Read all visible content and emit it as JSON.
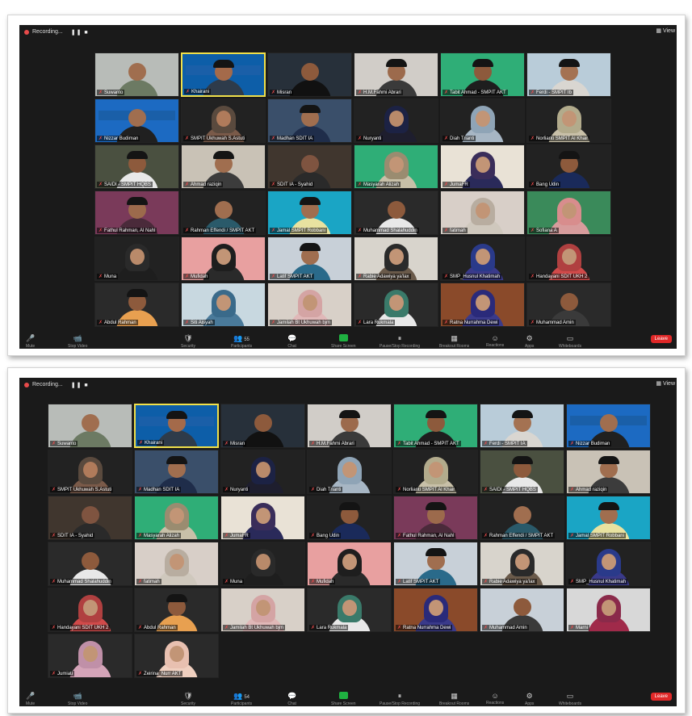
{
  "panels": [
    {
      "recording_label": "Recording...",
      "rec_controls": "❚❚ ■",
      "view_label": "View",
      "participants_count": "55",
      "leave_label": "Leave",
      "toolbar": [
        "Mute",
        "Stop Video",
        "Security",
        "Participants",
        "Chat",
        "Share Screen",
        "Pause/Stop Recording",
        "Breakout Rooms",
        "Reactions",
        "Apps",
        "Whiteboards"
      ],
      "tiles": [
        {
          "name": "Suwanto",
          "bg": "#b8bcb8",
          "skin": "#a06e4f",
          "shirt": "#6c7a63",
          "cap": false
        },
        {
          "name": "Khairani",
          "bg": "#0d5ea8",
          "skin": "#a46a4a",
          "shirt": "#2e3b4a",
          "cap": true,
          "active": true,
          "poster": true
        },
        {
          "name": "Misran",
          "bg": "#27303a",
          "skin": "#8d5a3c",
          "shirt": "#111111",
          "cap": false
        },
        {
          "name": "H.M.Fahmi Abrari",
          "bg": "#d1cdc8",
          "skin": "#9c6a4c",
          "shirt": "#3a3a3a",
          "cap": true
        },
        {
          "name": "Tabit Ahmad - SMPIT AKT",
          "bg": "#2fae77",
          "skin": "#8d5a3c",
          "shirt": "#1e1e1e",
          "cap": true
        },
        {
          "name": "Ferdi - SMPIT Ib",
          "bg": "#b9ccd9",
          "skin": "#a47252",
          "shirt": "#d9d6d1",
          "cap": true
        },
        {
          "name": "Nizzar Budiman",
          "bg": "#1c6ac2",
          "skin": "#a06e4f",
          "shirt": "#202020",
          "cap": false,
          "poster": true
        },
        {
          "name": "SMPIT Ukhuwah S.Astuti",
          "bg": "#222222",
          "skin": "#b07b5b",
          "shirt": "#7a5a49",
          "cap": false,
          "hijab": "#5a4a3e"
        },
        {
          "name": "Madhan SDIT IA",
          "bg": "#3a4f6a",
          "skin": "#a06e4f",
          "shirt": "#1f2d4a",
          "cap": true
        },
        {
          "name": "Nuryanti",
          "bg": "#222222",
          "skin": "#b98a6a",
          "shirt": "#1e1e2e",
          "cap": false,
          "hijab": "#1c2244"
        },
        {
          "name": "Diah Trianti",
          "bg": "#222222",
          "skin": "#c29576",
          "shirt": "#a7b6c4",
          "cap": false,
          "hijab": "#8fa4b6"
        },
        {
          "name": "Norlianti SMPIT Al Khair",
          "bg": "#222222",
          "skin": "#c29576",
          "shirt": "#c8c0a8",
          "cap": false,
          "hijab": "#b2ab8c"
        },
        {
          "name": "SAIDI - SMPIT HQBS",
          "bg": "#4a5040",
          "skin": "#8d5a3c",
          "shirt": "#e8e8e8",
          "cap": true
        },
        {
          "name": "Ahmad raziqin",
          "bg": "#c9c2b6",
          "skin": "#a06e4f",
          "shirt": "#3c3c3c",
          "cap": true
        },
        {
          "name": "SDIT IA - Syahid",
          "bg": "#40362e",
          "skin": "#7f5440",
          "shirt": "#2a2a2a",
          "cap": false
        },
        {
          "name": "Masyarah Alizah",
          "bg": "#2fae77",
          "skin": "#c29576",
          "shirt": "#c8c0a8",
          "cap": false,
          "hijab": "#9a8c70"
        },
        {
          "name": "JumaFR",
          "bg": "#e9e2d6",
          "skin": "#c29576",
          "shirt": "#2a2a5a",
          "cap": false,
          "hijab": "#3a2d5a"
        },
        {
          "name": "Bang Udin",
          "bg": "#222222",
          "skin": "#8d5a3c",
          "shirt": "#1a2a5a",
          "cap": true
        },
        {
          "name": "Fathul Rahman, Al Nahl",
          "bg": "#7a3a5a",
          "skin": "#9c6a4c",
          "shirt": "#4a2a3a",
          "cap": true
        },
        {
          "name": "Rahman Effendi / SMPIT AKT",
          "bg": "#222222",
          "skin": "#a06e4f",
          "shirt": "#2a5a6a",
          "cap": false
        },
        {
          "name": "Jamal SMPIT Robbani",
          "bg": "#1aa5c5",
          "skin": "#a06e4f",
          "shirt": "#e8e2a0",
          "cap": true
        },
        {
          "name": "Muhammad Shalahuddin",
          "bg": "#2a2a2a",
          "skin": "#8d5a3c",
          "shirt": "#e8e8e8",
          "cap": false
        },
        {
          "name": "fatimah",
          "bg": "#d8cfc8",
          "skin": "#c29576",
          "shirt": "#cfc8bd",
          "cap": false,
          "hijab": "#b8ada0"
        },
        {
          "name": "Sofiana A",
          "bg": "#3a8a5a",
          "skin": "#c29576",
          "shirt": "#d79c9c",
          "cap": false,
          "hijab": "#d88d8d"
        },
        {
          "name": "Muna",
          "bg": "#222222",
          "skin": "#b98a6a",
          "shirt": "#1e1e1e",
          "cap": false,
          "hijab": "#2a2a2a"
        },
        {
          "name": "Mufidah",
          "bg": "#e8a0a0",
          "skin": "#c29576",
          "shirt": "#2a2a2a",
          "cap": false,
          "hijab": "#1e1e1e"
        },
        {
          "name": "Latif SMPIT AKT",
          "bg": "#c8d0d8",
          "skin": "#a06e4f",
          "shirt": "#2a6a8a",
          "cap": true
        },
        {
          "name": "Rabie Adawiya ya'lax",
          "bg": "#d8d4cc",
          "skin": "#c29576",
          "shirt": "#6a5a4a",
          "cap": false,
          "hijab": "#2a2a2a"
        },
        {
          "name": "SMP_Husnul Khatimah",
          "bg": "#222222",
          "skin": "#c29576",
          "shirt": "#3a3a8a",
          "cap": false,
          "hijab": "#2a3a8a"
        },
        {
          "name": "Handayani SDIT UKH 2",
          "bg": "#222222",
          "skin": "#c29576",
          "shirt": "#d14a4a",
          "cap": false,
          "hijab": "#b04040"
        },
        {
          "name": "Abdul Rahman",
          "bg": "#2a2a2a",
          "skin": "#8d5a3c",
          "shirt": "#e8a050",
          "cap": true
        },
        {
          "name": "Siti Aisyah",
          "bg": "#c8d8e0",
          "skin": "#c29576",
          "shirt": "#4a7a9a",
          "cap": false,
          "hijab": "#3a6a8a"
        },
        {
          "name": "Jamilah Bt Ukhuwah bjm",
          "bg": "#d8d0c8",
          "skin": "#c29576",
          "shirt": "#e0b8b8",
          "cap": false,
          "hijab": "#d4a4a4"
        },
        {
          "name": "Lara Rukmala",
          "bg": "#2a2a2a",
          "skin": "#c29576",
          "shirt": "#e8e8e8",
          "cap": false,
          "hijab": "#3a7a6a"
        },
        {
          "name": "Ratna Nurrahma Dewi",
          "bg": "#8a4a2a",
          "skin": "#c29576",
          "shirt": "#3a3a8a",
          "cap": false,
          "hijab": "#2a2a7a"
        },
        {
          "name": "Muhammad Amin",
          "bg": "#2a2a2a",
          "skin": "#8d5a3c",
          "shirt": "#3a3a3a",
          "cap": false
        }
      ]
    },
    {
      "recording_label": "Recording...",
      "rec_controls": "❚❚ ■",
      "view_label": "View",
      "participants_count": "54",
      "leave_label": "Leave",
      "toolbar": [
        "Mute",
        "Stop Video",
        "Security",
        "Participants",
        "Chat",
        "Share Screen",
        "Pause/Stop Recording",
        "Breakout Rooms",
        "Reactions",
        "Apps",
        "Whiteboards"
      ],
      "tiles": [
        {
          "name": "Suwanto",
          "bg": "#b8bcb8",
          "skin": "#a06e4f",
          "shirt": "#6c7a63",
          "cap": false
        },
        {
          "name": "Khairani",
          "bg": "#0d5ea8",
          "skin": "#a46a4a",
          "shirt": "#2e3b4a",
          "cap": true,
          "active": true,
          "poster": true
        },
        {
          "name": "Misran",
          "bg": "#27303a",
          "skin": "#8d5a3c",
          "shirt": "#111111",
          "cap": false
        },
        {
          "name": "H.M.Fahmi Abrari",
          "bg": "#d1cdc8",
          "skin": "#9c6a4c",
          "shirt": "#3a3a3a",
          "cap": true
        },
        {
          "name": "Tabit Ahmad - SMPIT AKT",
          "bg": "#2fae77",
          "skin": "#8d5a3c",
          "shirt": "#1e1e1e",
          "cap": true
        },
        {
          "name": "Ferdi - SMPIT IA",
          "bg": "#b9ccd9",
          "skin": "#a47252",
          "shirt": "#d9d6d1",
          "cap": true
        },
        {
          "name": "Nizzar Budiman",
          "bg": "#1c6ac2",
          "skin": "#a06e4f",
          "shirt": "#202020",
          "cap": false,
          "poster": true
        },
        {
          "name": "SMPIT Ukhuwah S.Astuti",
          "bg": "#222222",
          "skin": "#b07b5b",
          "shirt": "#7a5a49",
          "cap": false,
          "hijab": "#5a4a3e"
        },
        {
          "name": "Madhan SDIT IA",
          "bg": "#3a4f6a",
          "skin": "#a06e4f",
          "shirt": "#1f2d4a",
          "cap": true
        },
        {
          "name": "Nuryanti",
          "bg": "#222222",
          "skin": "#b98a6a",
          "shirt": "#1e1e2e",
          "cap": false,
          "hijab": "#1c2244"
        },
        {
          "name": "Diah Trianti",
          "bg": "#222222",
          "skin": "#c29576",
          "shirt": "#a7b6c4",
          "cap": false,
          "hijab": "#8fa4b6"
        },
        {
          "name": "Norlianti SMPIT Al Khair",
          "bg": "#222222",
          "skin": "#c29576",
          "shirt": "#c8c0a8",
          "cap": false,
          "hijab": "#b2ab8c"
        },
        {
          "name": "SAIDI - SMPIT HQBS",
          "bg": "#4a5040",
          "skin": "#8d5a3c",
          "shirt": "#e8e8e8",
          "cap": true
        },
        {
          "name": "Ahmad raziqin",
          "bg": "#c9c2b6",
          "skin": "#a06e4f",
          "shirt": "#3c3c3c",
          "cap": true
        },
        {
          "name": "SDIT IA - Syahid",
          "bg": "#40362e",
          "skin": "#7f5440",
          "shirt": "#2a2a2a",
          "cap": false
        },
        {
          "name": "Masyarah Alizah",
          "bg": "#2fae77",
          "skin": "#c29576",
          "shirt": "#c8c0a8",
          "cap": false,
          "hijab": "#9a8c70"
        },
        {
          "name": "JumaFR",
          "bg": "#e9e2d6",
          "skin": "#c29576",
          "shirt": "#2a2a5a",
          "cap": false,
          "hijab": "#3a2d5a"
        },
        {
          "name": "Bang Udin",
          "bg": "#222222",
          "skin": "#8d5a3c",
          "shirt": "#1a2a5a",
          "cap": true
        },
        {
          "name": "Fathul Rahman, Al Nahl",
          "bg": "#7a3a5a",
          "skin": "#9c6a4c",
          "shirt": "#4a2a3a",
          "cap": true
        },
        {
          "name": "Rahman Effendi / SMPIT AKT",
          "bg": "#222222",
          "skin": "#a06e4f",
          "shirt": "#2a5a6a",
          "cap": false
        },
        {
          "name": "Jamal SMPIT Robbani",
          "bg": "#1aa5c5",
          "skin": "#a06e4f",
          "shirt": "#e8e2a0",
          "cap": true
        },
        {
          "name": "Muhammad Shalahuddin",
          "bg": "#2a2a2a",
          "skin": "#8d5a3c",
          "shirt": "#e8e8e8",
          "cap": false
        },
        {
          "name": "fatimah",
          "bg": "#d8cfc8",
          "skin": "#c29576",
          "shirt": "#cfc8bd",
          "cap": false,
          "hijab": "#b8ada0"
        },
        {
          "name": "Muna",
          "bg": "#222222",
          "skin": "#b98a6a",
          "shirt": "#1e1e1e",
          "cap": false,
          "hijab": "#2a2a2a"
        },
        {
          "name": "Mufidah",
          "bg": "#e8a0a0",
          "skin": "#c29576",
          "shirt": "#2a2a2a",
          "cap": false,
          "hijab": "#1e1e1e"
        },
        {
          "name": "Latif SMPIT AKT",
          "bg": "#c8d0d8",
          "skin": "#a06e4f",
          "shirt": "#2a6a8a",
          "cap": true
        },
        {
          "name": "Rabie Adawiya ya'lax",
          "bg": "#d8d4cc",
          "skin": "#c29576",
          "shirt": "#6a5a4a",
          "cap": false,
          "hijab": "#2a2a2a"
        },
        {
          "name": "SMP_Husnul Khatimah",
          "bg": "#222222",
          "skin": "#c29576",
          "shirt": "#3a3a8a",
          "cap": false,
          "hijab": "#2a3a8a"
        },
        {
          "name": "Handayani SDIT UKH 2",
          "bg": "#222222",
          "skin": "#c29576",
          "shirt": "#d14a4a",
          "cap": false,
          "hijab": "#b04040"
        },
        {
          "name": "Abdul Rahman",
          "bg": "#2a2a2a",
          "skin": "#8d5a3c",
          "shirt": "#e8a050",
          "cap": true
        },
        {
          "name": "Jamilah Bt Ukhuwah bjm",
          "bg": "#d8d0c8",
          "skin": "#c29576",
          "shirt": "#e0b8b8",
          "cap": false,
          "hijab": "#d4a4a4"
        },
        {
          "name": "Lara Rukmala",
          "bg": "#2a2a2a",
          "skin": "#c29576",
          "shirt": "#e8e8e8",
          "cap": false,
          "hijab": "#3a7a6a"
        },
        {
          "name": "Ratna Nurrahma Dewi",
          "bg": "#8a4a2a",
          "skin": "#c29576",
          "shirt": "#3a3a8a",
          "cap": false,
          "hijab": "#2a2a7a"
        },
        {
          "name": "Muhammad Amin",
          "bg": "#c8d0d8",
          "skin": "#8d5a3c",
          "shirt": "#3a3a3a",
          "cap": false
        },
        {
          "name": "Marni",
          "bg": "#d8d8d8",
          "skin": "#c29576",
          "shirt": "#a02a4a",
          "cap": false,
          "hijab": "#8a2a4a"
        },
        {
          "name": "Jumiati",
          "bg": "#2a2a2a",
          "skin": "#c29576",
          "shirt": "#d4a4b8",
          "cap": false,
          "hijab": "#c090a8"
        },
        {
          "name": "Zeirina_Nurr AKT",
          "bg": "#2a2a2a",
          "skin": "#c29576",
          "shirt": "#f0d0c0",
          "cap": false,
          "hijab": "#e8c0b0"
        }
      ]
    }
  ]
}
